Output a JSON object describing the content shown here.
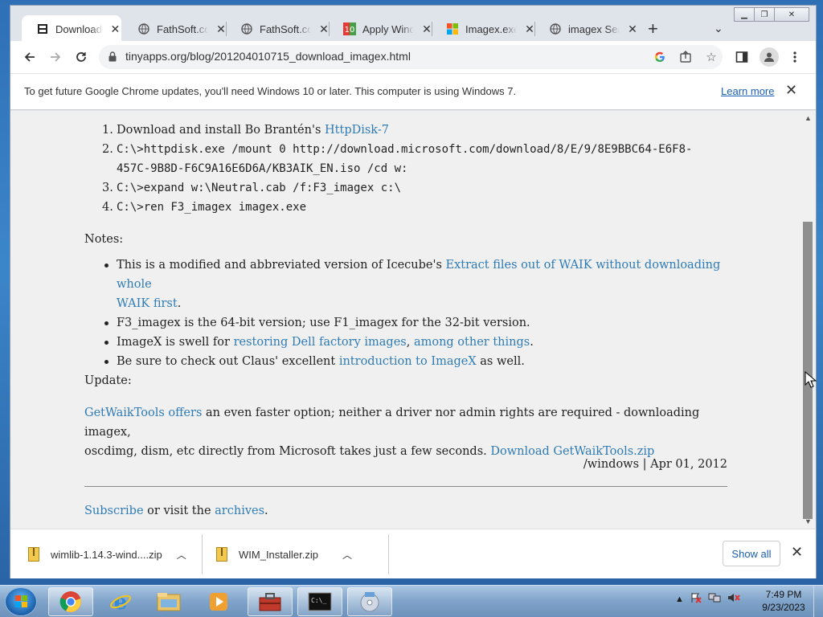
{
  "browser": {
    "tabs": [
      {
        "title": "Download ju",
        "icon": "page-icon",
        "active": true
      },
      {
        "title": "FathSoft.com",
        "icon": "globe-icon",
        "active": false
      },
      {
        "title": "FathSoft.com",
        "icon": "globe-icon",
        "active": false
      },
      {
        "title": "Apply Windo",
        "icon": "app-logo-icon",
        "active": false
      },
      {
        "title": "Imagex.exe",
        "icon": "microsoft-logo-icon",
        "active": false
      },
      {
        "title": "imagex Sear",
        "icon": "globe-icon",
        "active": false
      }
    ],
    "url": "tinyapps.org/blog/201204010715_download_imagex.html",
    "infobar": {
      "message": "To get future Google Chrome updates, you'll need Windows 10 or later. This computer is using Windows 7.",
      "learn_more": "Learn more"
    }
  },
  "article": {
    "steps": [
      {
        "num": "1.",
        "pre": "Download and install Bo Brantén's ",
        "link": "HttpDisk-7"
      },
      {
        "num": "2.",
        "code_l1": "C:\\>httpdisk.exe /mount 0 http://download.microsoft.com/download/8/E/9/8E9BBC64-E6F8-",
        "code_l2": "457C-9B8D-F6C9A16E6D6A/KB3AIK_EN.iso /cd w:"
      },
      {
        "num": "3.",
        "code": "C:\\>expand w:\\Neutral.cab /f:F3_imagex c:\\"
      },
      {
        "num": "4.",
        "code": "C:\\>ren F3_imagex imagex.exe"
      }
    ],
    "notes_label": "Notes:",
    "notes": {
      "n1_pre": "This is a modified and abbreviated version of Icecube's ",
      "n1_link_l1": "Extract files out of WAIK without downloading whole",
      "n1_link_l2": "WAIK first",
      "n1_post": ".",
      "n2": "F3_imagex is the 64-bit version; use F1_imagex for the 32-bit version.",
      "n3_pre": "ImageX is swell for ",
      "n3_link1": "restoring Dell factory images",
      "n3_mid": ", ",
      "n3_link2": "among other things",
      "n3_post": ".",
      "n4_pre": "Be sure to check out Claus' excellent ",
      "n4_link": "introduction to ImageX",
      "n4_post": " as well."
    },
    "update_label": "Update:",
    "update": {
      "link1": "GetWaikTools offers",
      "l1_text": " an even faster option; neither a driver nor admin rights are required - downloading imagex,",
      "l2_text": "oscdimg, dism, etc directly from Microsoft takes just a few seconds. ",
      "link2": "Download GetWaikTools.zip"
    },
    "footer_meta": "/windows | Apr 01, 2012",
    "subscribe_link": "Subscribe",
    "subscribe_mid": " or visit the ",
    "archives_link": "archives",
    "subscribe_end": "."
  },
  "downloads": {
    "items": [
      {
        "name": "wimlib-1.14.3-wind....zip"
      },
      {
        "name": "WIM_Installer.zip"
      }
    ],
    "show_all": "Show all"
  },
  "taskbar": {
    "apps": [
      "chrome-icon",
      "internet-explorer-icon",
      "file-explorer-icon",
      "media-player-icon",
      "toolbox-icon",
      "command-prompt-icon",
      "disc-tool-icon"
    ],
    "time": "7:49 PM",
    "date": "9/23/2023"
  },
  "colors": {
    "link": "#2e7bb5",
    "page_bg": "#f0f0f0",
    "accent": "#1a5fb4"
  }
}
